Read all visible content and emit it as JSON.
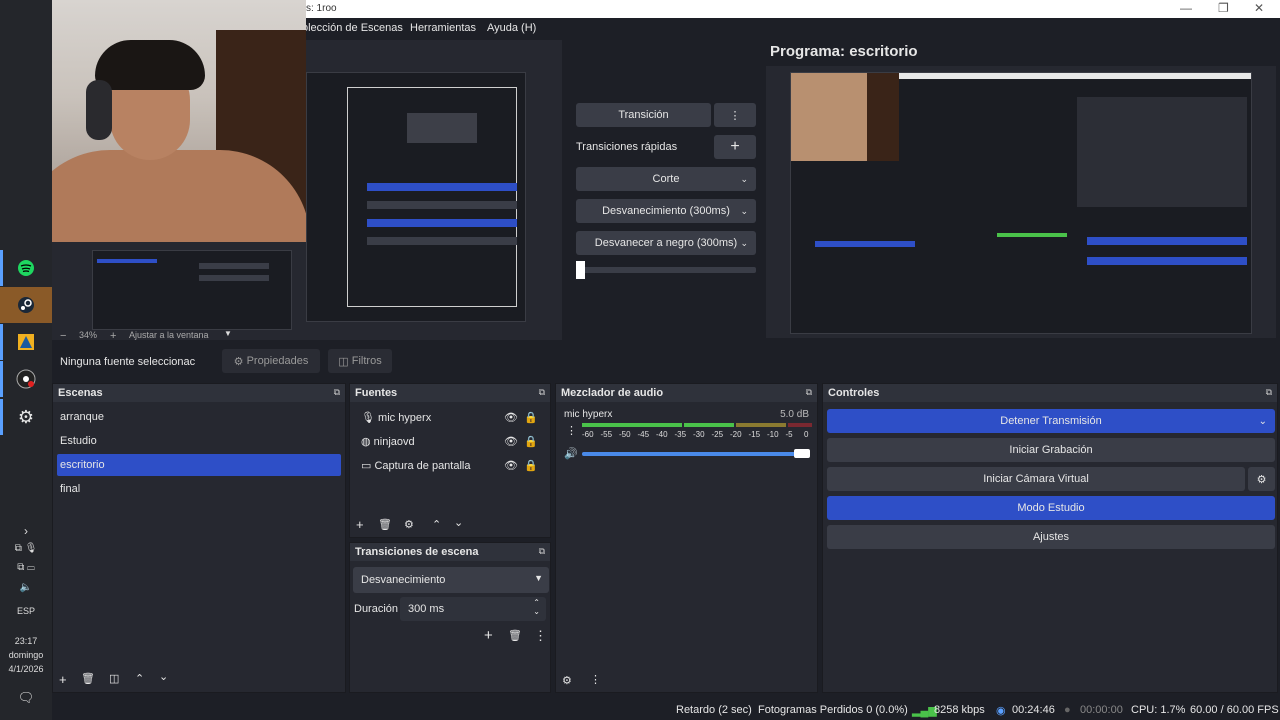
{
  "window": {
    "title": "s: 1roo"
  },
  "menu": {
    "items": [
      "olección de Escenas",
      "Herramientas",
      "Ayuda (H)"
    ]
  },
  "program": {
    "title": "Programa: escritorio"
  },
  "preview": {
    "zoom": "34%",
    "fit": "Ajustar a la ventana"
  },
  "transitions_panel": {
    "transition_label": "Transición",
    "quick_label": "Transiciones rápidas",
    "buttons": [
      "Corte",
      "Desvanecimiento (300ms)",
      "Desvanecer a negro (300ms)"
    ]
  },
  "source_bar": {
    "no_source": "Ninguna fuente seleccionac",
    "properties": "Propiedades",
    "filters": "Filtros"
  },
  "scenes": {
    "title": "Escenas",
    "items": [
      "arranque",
      "Estudio",
      "escritorio",
      "final"
    ],
    "selected": 2
  },
  "sources": {
    "title": "Fuentes",
    "items": [
      "mic hyperx",
      "ninjaovd",
      "Captura de pantalla"
    ]
  },
  "scene_transitions": {
    "title": "Transiciones de escena",
    "type": "Desvanecimiento",
    "duration_label": "Duración",
    "duration": "300 ms"
  },
  "mixer": {
    "title": "Mezclador de audio",
    "channel": "mic hyperx",
    "db": "5.0 dB",
    "ticks": [
      "-60",
      "-55",
      "-50",
      "-45",
      "-40",
      "-35",
      "-30",
      "-25",
      "-20",
      "-15",
      "-10",
      "-5",
      "0"
    ],
    "volume_fraction": 1.0
  },
  "controls": {
    "title": "Controles",
    "stop_stream": "Detener Transmisión",
    "start_record": "Iniciar Grabación",
    "virtual_cam": "Iniciar Cámara Virtual",
    "studio_mode": "Modo Estudio",
    "settings": "Ajustes"
  },
  "status": {
    "delay": "Retardo (2 sec)",
    "dropped": "Fotogramas Perdidos 0 (0.0%)",
    "bitrate": "8258 kbps",
    "stream_time": "00:24:46",
    "rec_time": "00:00:00",
    "cpu": "CPU: 1.7%",
    "fps": "60.00 / 60.00 FPS"
  },
  "taskbar": {
    "lang": "ESP",
    "time": "23:17",
    "day": "domingo",
    "date": "4/1/2026"
  },
  "colors": {
    "accent": "#2e4fc7",
    "bg": "#1d1f26",
    "panel": "#262830",
    "button": "#3a3d47"
  }
}
